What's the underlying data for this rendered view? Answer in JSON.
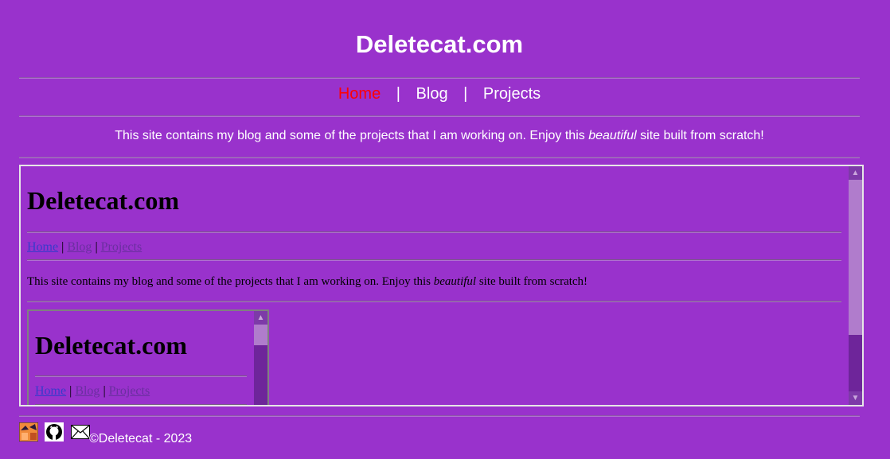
{
  "site": {
    "title": "Deletecat.com",
    "nav": {
      "home": "Home",
      "blog": "Blog",
      "projects": "Projects",
      "sep": "|"
    },
    "intro_before": "This site contains my blog and some of the projects that I am working on. Enjoy this ",
    "intro_em": "beautiful",
    "intro_after": " site built from scratch!",
    "footer": "©Deletecat - 2023"
  },
  "colors": {
    "background": "#9932cc",
    "active_nav": "#ff0000",
    "frame_border": "#e6e6e6"
  },
  "icons": [
    "blog-icon",
    "github-icon",
    "mail-icon"
  ]
}
